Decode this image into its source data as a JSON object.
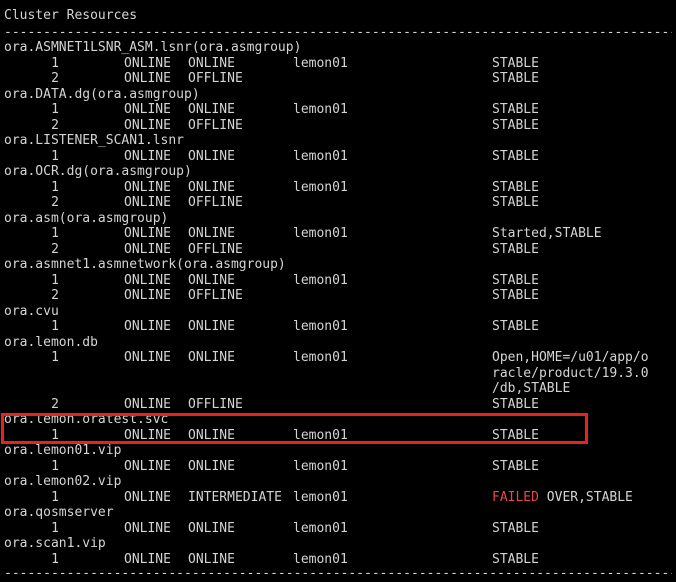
{
  "header": {
    "title": "Cluster Resources",
    "separator": "--------------------------------------------------------------------------------------------------------------------"
  },
  "colors": {
    "background": "#000000",
    "text": "#d4d4d4",
    "failed": "#e8484b",
    "highlight_border": "#e8231f"
  },
  "resources": [
    {
      "name": "ora.ASMNET1LSNR_ASM.lsnr(ora.asmgroup)",
      "rows": [
        {
          "num": "1",
          "target": "ONLINE",
          "state": "ONLINE",
          "server": "lemon01",
          "details": [
            "STABLE"
          ]
        },
        {
          "num": "2",
          "target": "ONLINE",
          "state": "OFFLINE",
          "server": "",
          "details": [
            "STABLE"
          ]
        }
      ]
    },
    {
      "name": "ora.DATA.dg(ora.asmgroup)",
      "rows": [
        {
          "num": "1",
          "target": "ONLINE",
          "state": "ONLINE",
          "server": "lemon01",
          "details": [
            "STABLE"
          ]
        },
        {
          "num": "2",
          "target": "ONLINE",
          "state": "OFFLINE",
          "server": "",
          "details": [
            "STABLE"
          ]
        }
      ]
    },
    {
      "name": "ora.LISTENER_SCAN1.lsnr",
      "rows": [
        {
          "num": "1",
          "target": "ONLINE",
          "state": "ONLINE",
          "server": "lemon01",
          "details": [
            "STABLE"
          ]
        }
      ]
    },
    {
      "name": "ora.OCR.dg(ora.asmgroup)",
      "rows": [
        {
          "num": "1",
          "target": "ONLINE",
          "state": "ONLINE",
          "server": "lemon01",
          "details": [
            "STABLE"
          ]
        },
        {
          "num": "2",
          "target": "ONLINE",
          "state": "OFFLINE",
          "server": "",
          "details": [
            "STABLE"
          ]
        }
      ]
    },
    {
      "name": "ora.asm(ora.asmgroup)",
      "rows": [
        {
          "num": "1",
          "target": "ONLINE",
          "state": "ONLINE",
          "server": "lemon01",
          "details": [
            "Started,STABLE"
          ]
        },
        {
          "num": "2",
          "target": "ONLINE",
          "state": "OFFLINE",
          "server": "",
          "details": [
            "STABLE"
          ]
        }
      ]
    },
    {
      "name": "ora.asmnet1.asmnetwork(ora.asmgroup)",
      "rows": [
        {
          "num": "1",
          "target": "ONLINE",
          "state": "ONLINE",
          "server": "lemon01",
          "details": [
            "STABLE"
          ]
        },
        {
          "num": "2",
          "target": "ONLINE",
          "state": "OFFLINE",
          "server": "",
          "details": [
            "STABLE"
          ]
        }
      ]
    },
    {
      "name": "ora.cvu",
      "rows": [
        {
          "num": "1",
          "target": "ONLINE",
          "state": "ONLINE",
          "server": "lemon01",
          "details": [
            "STABLE"
          ]
        }
      ]
    },
    {
      "name": "ora.lemon.db",
      "rows": [
        {
          "num": "1",
          "target": "ONLINE",
          "state": "ONLINE",
          "server": "lemon01",
          "details": [
            "Open,HOME=/u01/app/o",
            "racle/product/19.3.0",
            "/db,STABLE"
          ]
        },
        {
          "num": "2",
          "target": "ONLINE",
          "state": "OFFLINE",
          "server": "",
          "details": [
            "STABLE"
          ]
        }
      ]
    },
    {
      "name": "ora.lemon.oratest.svc",
      "highlighted": true,
      "rows": [
        {
          "num": "1",
          "target": "ONLINE",
          "state": "ONLINE",
          "server": "lemon01",
          "details": [
            "STABLE"
          ]
        }
      ]
    },
    {
      "name": "ora.lemon01.vip",
      "rows": [
        {
          "num": "1",
          "target": "ONLINE",
          "state": "ONLINE",
          "server": "lemon01",
          "details": [
            "STABLE"
          ]
        }
      ]
    },
    {
      "name": "ora.lemon02.vip",
      "rows": [
        {
          "num": "1",
          "target": "ONLINE",
          "state": "INTERMEDIATE",
          "server": "lemon01",
          "details_failed": "FAILED",
          "details": [
            " OVER,STABLE"
          ]
        }
      ]
    },
    {
      "name": "ora.qosmserver",
      "rows": [
        {
          "num": "1",
          "target": "ONLINE",
          "state": "ONLINE",
          "server": "lemon01",
          "details": [
            "STABLE"
          ]
        }
      ]
    },
    {
      "name": "ora.scan1.vip",
      "rows": [
        {
          "num": "1",
          "target": "ONLINE",
          "state": "ONLINE",
          "server": "lemon01",
          "details": [
            "STABLE"
          ]
        }
      ]
    }
  ]
}
